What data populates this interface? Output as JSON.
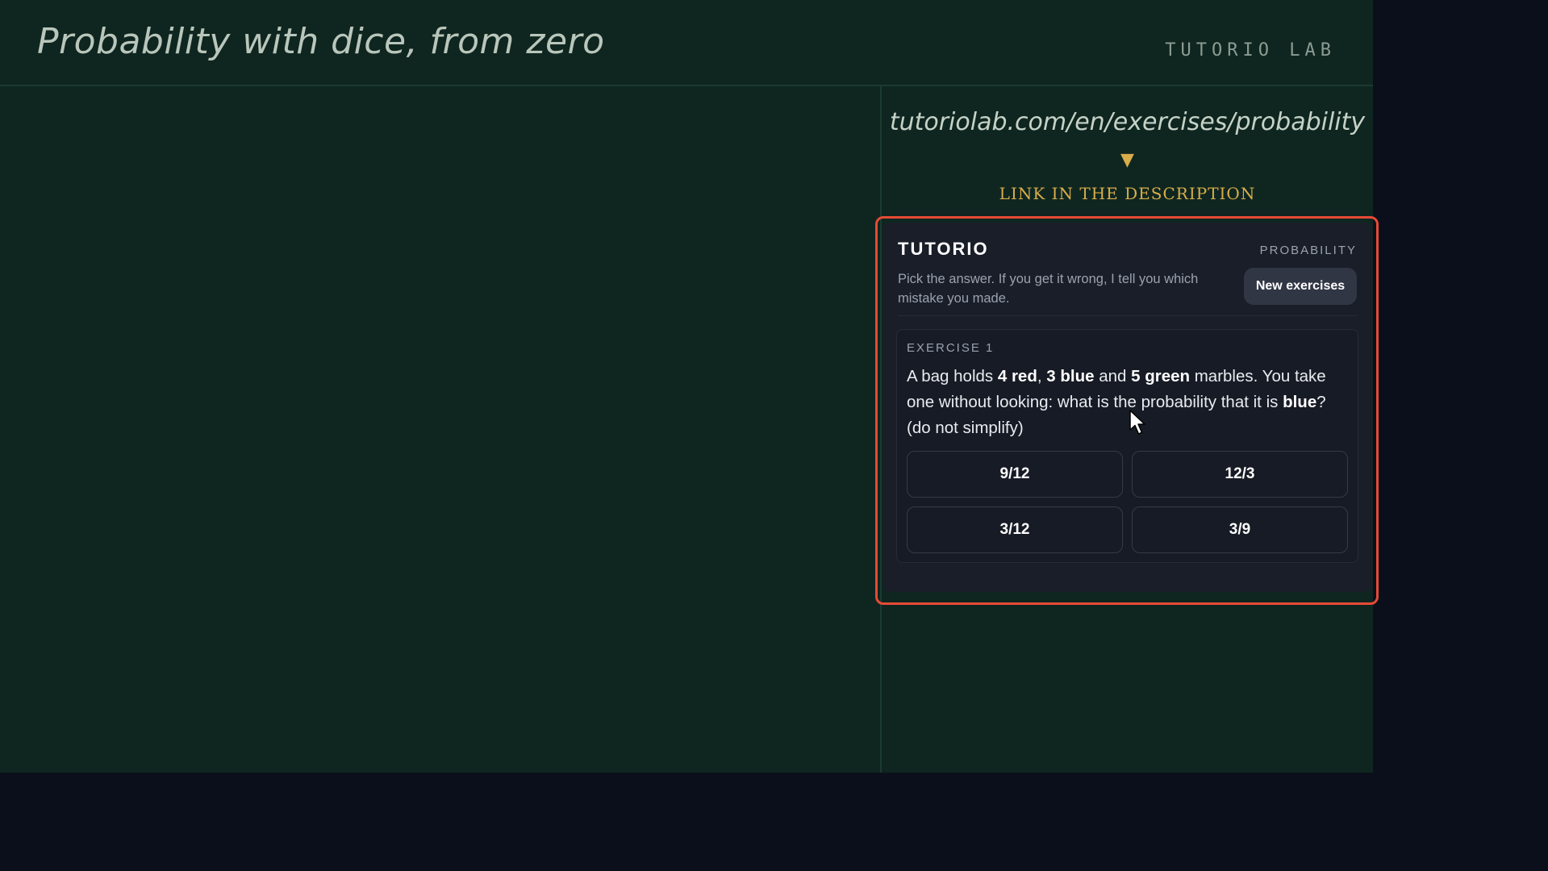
{
  "header": {
    "title": "Probability with dice, from zero",
    "brand": "TUTORIO LAB"
  },
  "promo": {
    "url": "tutoriolab.com/en/exercises/probability",
    "arrow": "▼",
    "cta": "LINK IN THE DESCRIPTION"
  },
  "card": {
    "logo": "TUTORIO",
    "topic": "PROBABILITY",
    "subtitle": "Pick the answer. If you get it wrong, I tell you which mistake you made.",
    "new_exercises_label": "New exercises",
    "exercise": {
      "label": "EXERCISE 1",
      "question": {
        "p1": "A bag holds ",
        "red": "4 red",
        "p2": ", ",
        "blue_count": "3 blue",
        "p3": " and ",
        "green": "5 green",
        "p4": " marbles. You take one without looking: what is the probability that it is ",
        "blue": "blue",
        "p5": "? (do not simplify)"
      },
      "options": [
        "9/12",
        "12/3",
        "3/12",
        "3/9"
      ]
    }
  },
  "colors": {
    "stage_bg": "#0f2620",
    "outer_bg": "#0b0f1b",
    "card_bg": "#1a1e28",
    "highlight_outline": "#e64a35",
    "accent_gold": "#d8ad4a"
  },
  "icons": {
    "cursor": "mouse-pointer-icon"
  }
}
